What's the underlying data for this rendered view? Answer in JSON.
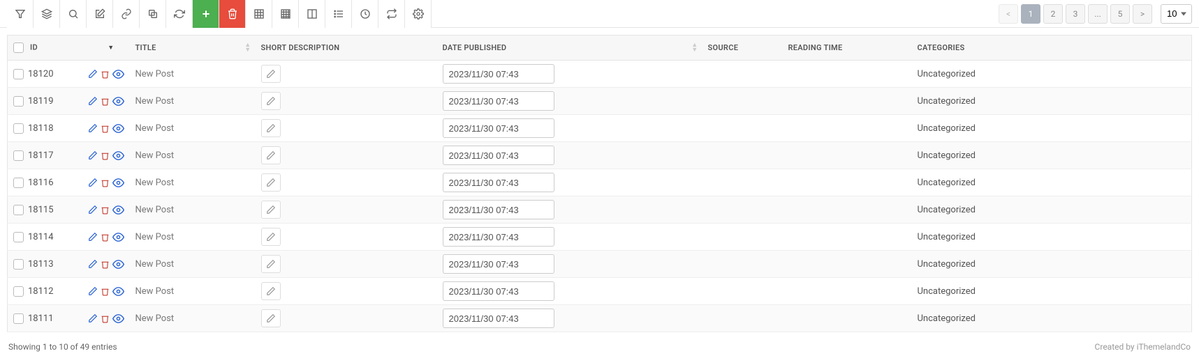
{
  "toolbar": {
    "icons": [
      "filter",
      "layers",
      "search",
      "edit",
      "link",
      "copy",
      "refresh",
      "plus",
      "trash",
      "table",
      "grid",
      "columns",
      "list-ul",
      "clock",
      "sync",
      "gear"
    ]
  },
  "pagination": {
    "prev": "<",
    "pages": [
      "1",
      "2",
      "3",
      "...",
      "5"
    ],
    "next": ">",
    "active": 0,
    "page_size": "10"
  },
  "columns": {
    "id": "ID",
    "title": "TITLE",
    "short_desc": "SHORT DESCRIPTION",
    "date_published": "DATE PUBLISHED",
    "source": "SOURCE",
    "reading_time": "READING TIME",
    "categories": "CATEGORIES"
  },
  "rows": [
    {
      "id": "18120",
      "title": "New Post",
      "date": "2023/11/30 07:43",
      "category": "Uncategorized"
    },
    {
      "id": "18119",
      "title": "New Post",
      "date": "2023/11/30 07:43",
      "category": "Uncategorized"
    },
    {
      "id": "18118",
      "title": "New Post",
      "date": "2023/11/30 07:43",
      "category": "Uncategorized"
    },
    {
      "id": "18117",
      "title": "New Post",
      "date": "2023/11/30 07:43",
      "category": "Uncategorized"
    },
    {
      "id": "18116",
      "title": "New Post",
      "date": "2023/11/30 07:43",
      "category": "Uncategorized"
    },
    {
      "id": "18115",
      "title": "New Post",
      "date": "2023/11/30 07:43",
      "category": "Uncategorized"
    },
    {
      "id": "18114",
      "title": "New Post",
      "date": "2023/11/30 07:43",
      "category": "Uncategorized"
    },
    {
      "id": "18113",
      "title": "New Post",
      "date": "2023/11/30 07:43",
      "category": "Uncategorized"
    },
    {
      "id": "18112",
      "title": "New Post",
      "date": "2023/11/30 07:43",
      "category": "Uncategorized"
    },
    {
      "id": "18111",
      "title": "New Post",
      "date": "2023/11/30 07:43",
      "category": "Uncategorized"
    }
  ],
  "footer": {
    "info": "Showing 1 to 10 of 49 entries",
    "credit": "Created by iThemelandCo"
  }
}
